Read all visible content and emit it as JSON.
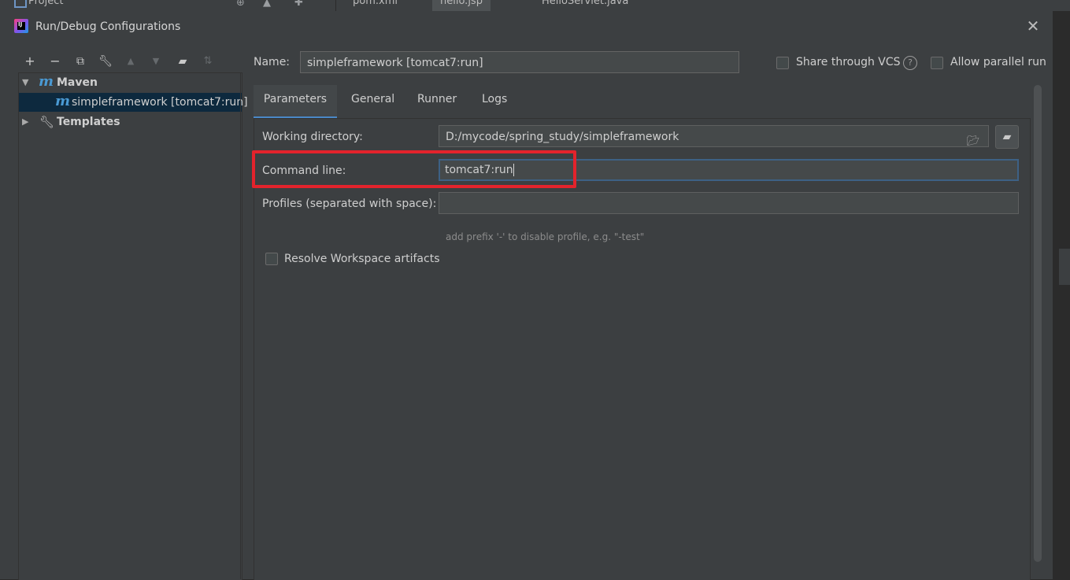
{
  "ide": {
    "project_label": "Project",
    "tabs": [
      {
        "label": "pom.xml"
      },
      {
        "label": "hello.jsp"
      },
      {
        "label": "HelloServlet.java"
      }
    ]
  },
  "dialog": {
    "title": "Run/Debug Configurations",
    "close_glyph": "✕"
  },
  "toolbar": {
    "icons": [
      "add-icon",
      "remove-icon",
      "copy-icon",
      "wrench-icon",
      "move-up-icon",
      "move-down-icon",
      "new-folder-icon",
      "sort-icon"
    ]
  },
  "tree": {
    "maven_label": "Maven",
    "config_label": "simpleframework [tomcat7:run]",
    "templates_label": "Templates"
  },
  "form": {
    "name_label": "Name:",
    "name_value": "simpleframework [tomcat7:run]",
    "share_vcs_label": "Share through VCS",
    "allow_parallel_label": "Allow parallel run",
    "share_vcs_checked": false,
    "allow_parallel_checked": false
  },
  "tabs": [
    {
      "label": "Parameters",
      "active": true
    },
    {
      "label": "General",
      "active": false
    },
    {
      "label": "Runner",
      "active": false
    },
    {
      "label": "Logs",
      "active": false
    }
  ],
  "parameters": {
    "working_dir_label": "Working directory:",
    "working_dir_value": "D:/mycode/spring_study/simpleframework",
    "command_line_label": "Command line:",
    "command_line_value": "tomcat7:run",
    "profiles_label": "Profiles (separated with space):",
    "profiles_value": "",
    "profiles_hint": "add prefix '-' to disable profile, e.g. \"-test\"",
    "resolve_workspace_label": "Resolve Workspace artifacts",
    "resolve_workspace_checked": false
  },
  "colors": {
    "dialog_bg": "#3c3f41",
    "selection_bg": "#0d293e",
    "accent": "#4a88c7",
    "highlight_box": "#e3232c",
    "maven_icon": "#4a9ad4"
  }
}
